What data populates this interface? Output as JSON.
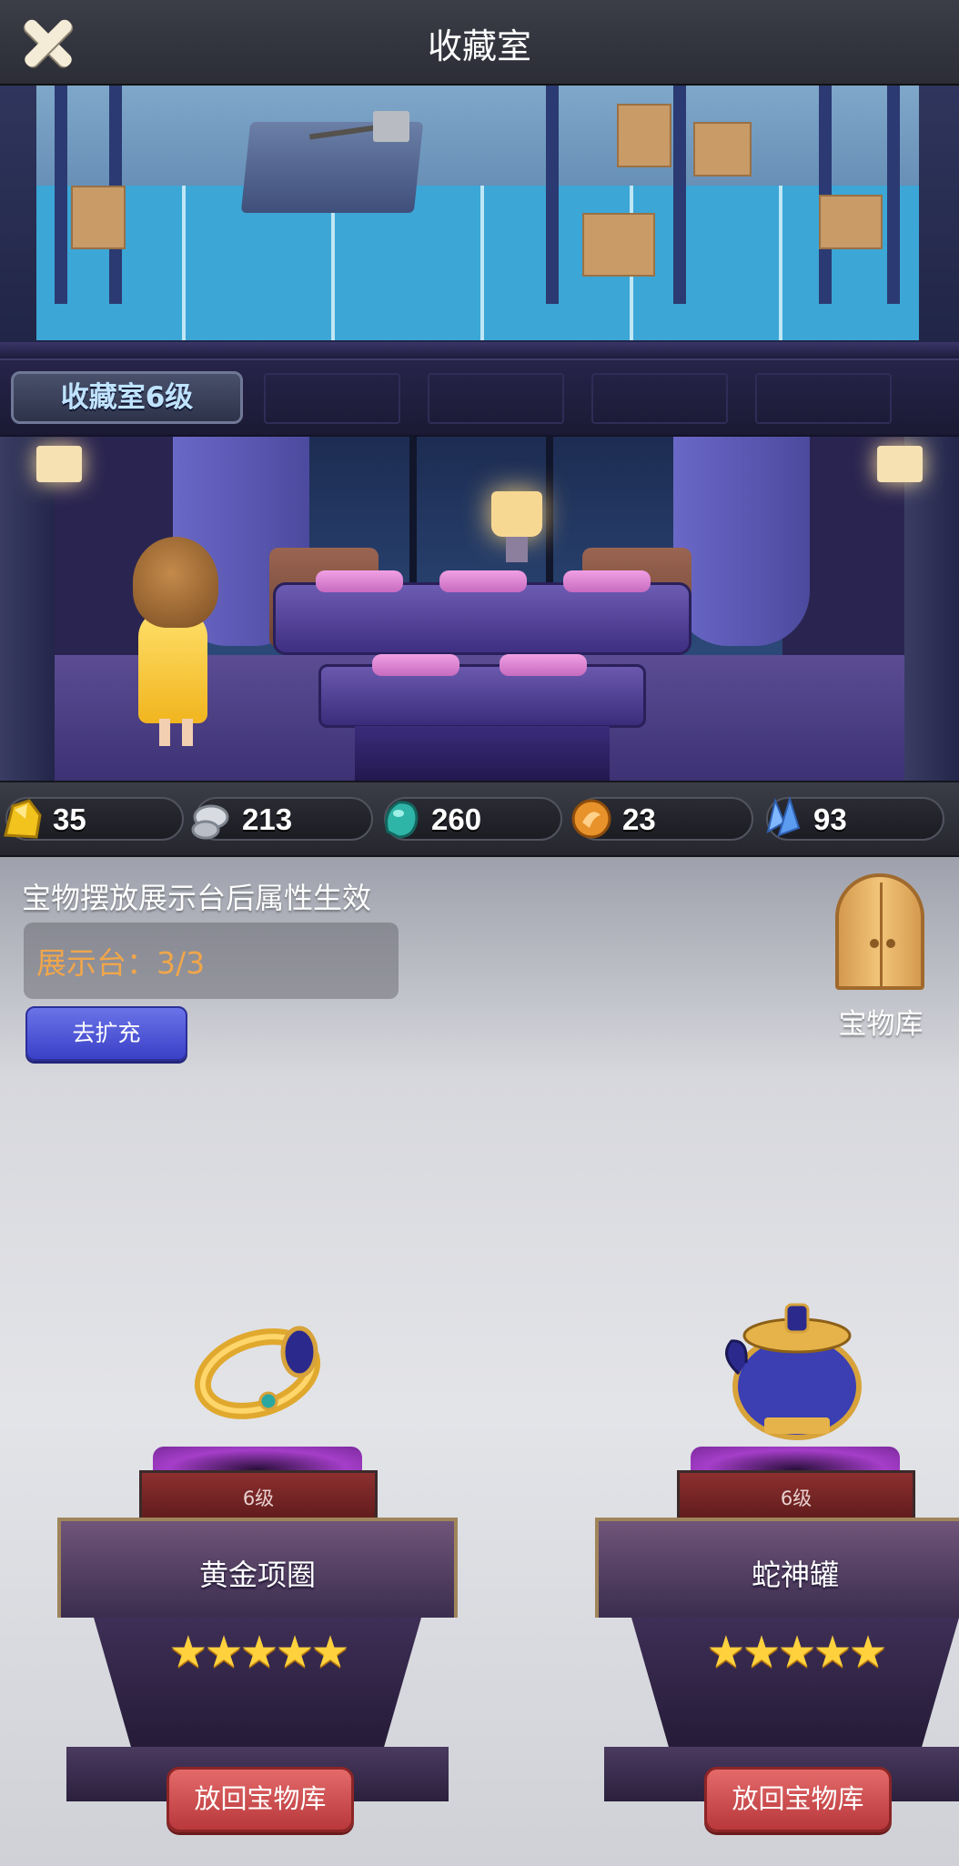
{
  "header": {
    "title": "收藏室",
    "close_icon": "close-icon"
  },
  "scene": {
    "level_label": "收藏室6级"
  },
  "resources": [
    {
      "icon": "gold-ore-icon",
      "value": "35",
      "color": "#f2c21d"
    },
    {
      "icon": "silver-ore-icon",
      "value": "213",
      "color": "#c9cdd3"
    },
    {
      "icon": "jade-icon",
      "value": "260",
      "color": "#2fb5a8"
    },
    {
      "icon": "bronze-coin-icon",
      "value": "23",
      "color": "#e7922a"
    },
    {
      "icon": "crystal-icon",
      "value": "93",
      "color": "#5b9cf0"
    }
  ],
  "panel": {
    "hint": "宝物摆放展示台后属性生效",
    "stand_text": "展示台：3/3",
    "expand_label": "去扩充",
    "vault_label": "宝物库"
  },
  "treasures": [
    {
      "name": "黄金项圈",
      "level": "6级",
      "stars": "★★★★★",
      "star_count": 5,
      "button": "放回宝物库",
      "icon": "golden-ring-icon"
    },
    {
      "name": "蛇神罐",
      "level": "6级",
      "stars": "★★★★★",
      "star_count": 5,
      "button": "放回宝物库",
      "icon": "serpent-jar-icon"
    }
  ]
}
